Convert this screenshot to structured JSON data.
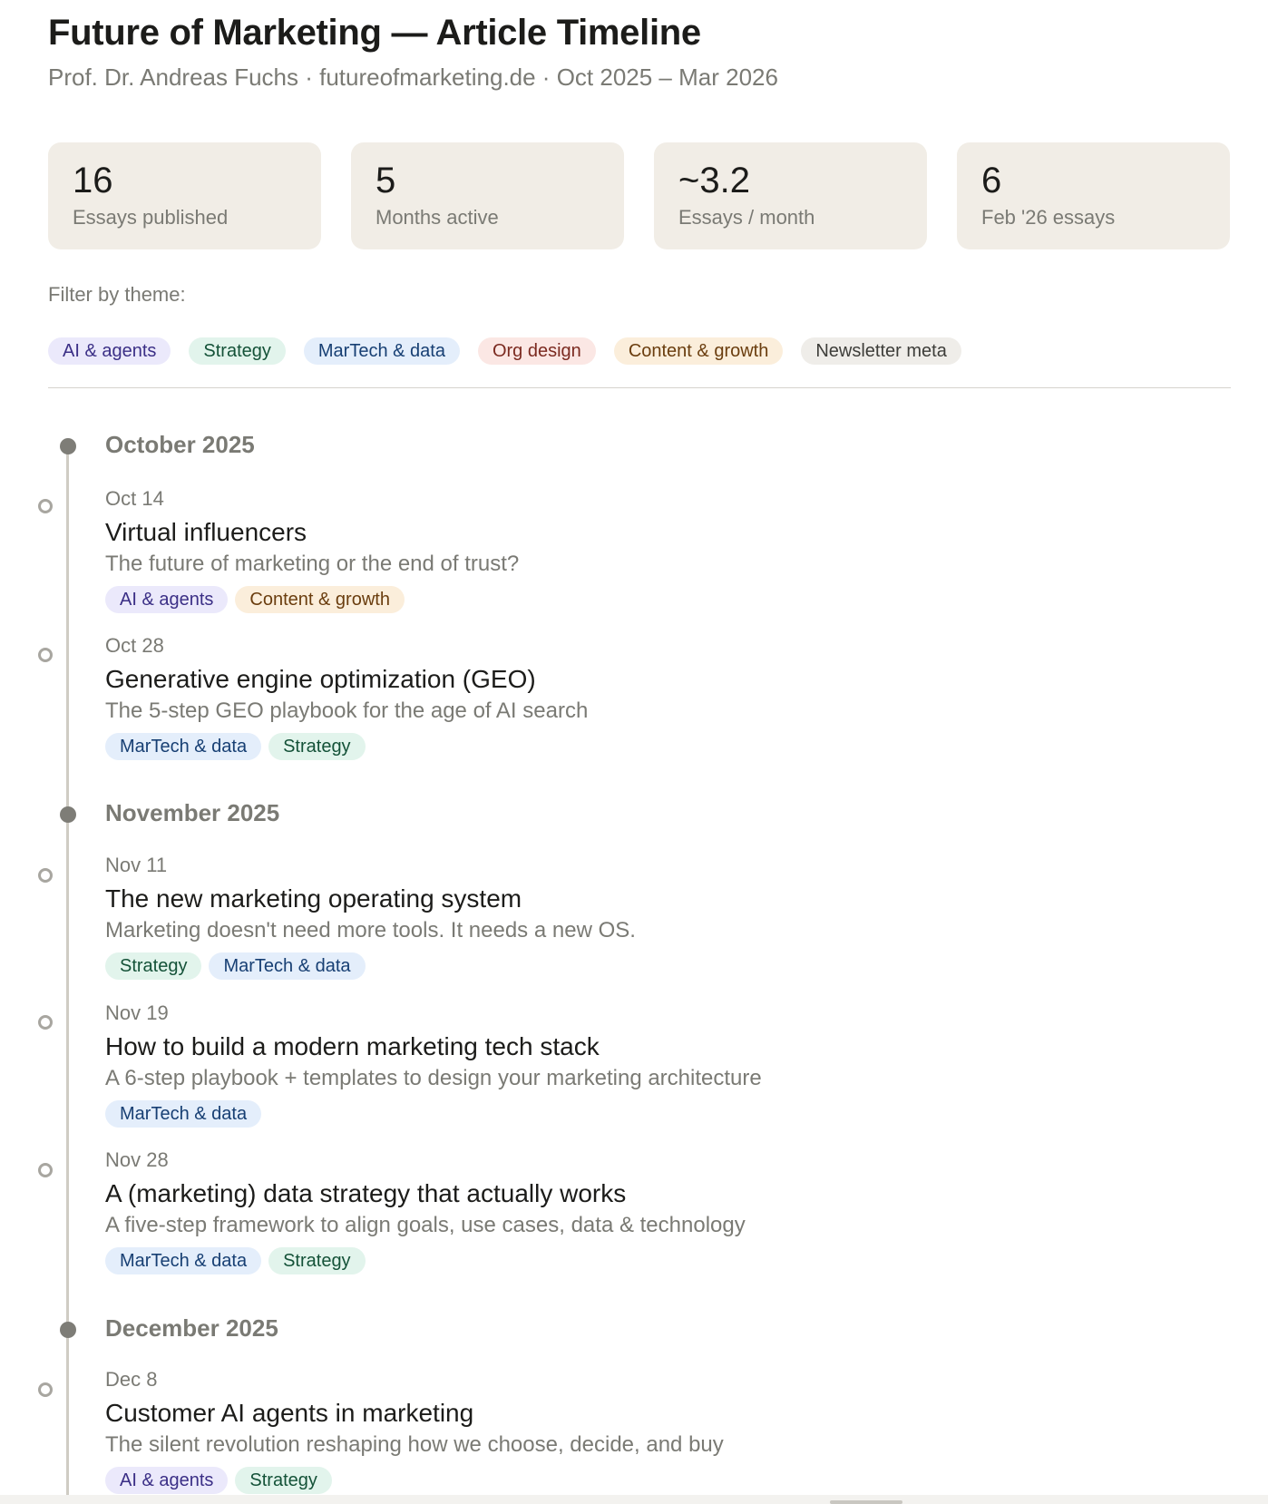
{
  "header": {
    "title": "Future of Marketing — Article Timeline",
    "subtitle": "Prof. Dr. Andreas Fuchs · futureofmarketing.de · Oct 2025 – Mar 2026"
  },
  "stats": [
    {
      "value": "16",
      "label": "Essays published"
    },
    {
      "value": "5",
      "label": "Months active"
    },
    {
      "value": "~3.2",
      "label": "Essays / month"
    },
    {
      "value": "6",
      "label": "Feb '26 essays"
    }
  ],
  "filter": {
    "label": "Filter by theme:",
    "themes": [
      "AI & agents",
      "Strategy",
      "MarTech & data",
      "Org design",
      "Content & growth",
      "Newsletter meta"
    ]
  },
  "timeline": {
    "months": [
      "October 2025",
      "November 2025",
      "December 2025"
    ],
    "entries": [
      {
        "date": "Oct 14",
        "title": "Virtual influencers",
        "desc": "The future of marketing or the end of trust?",
        "tags": [
          "AI & agents",
          "Content & growth"
        ]
      },
      {
        "date": "Oct 28",
        "title": "Generative engine optimization (GEO)",
        "desc": "The 5-step GEO playbook for the age of AI search",
        "tags": [
          "MarTech & data",
          "Strategy"
        ]
      },
      {
        "date": "Nov 11",
        "title": "The new marketing operating system",
        "desc": "Marketing doesn't need more tools. It needs a new OS.",
        "tags": [
          "Strategy",
          "MarTech & data"
        ]
      },
      {
        "date": "Nov 19",
        "title": "How to build a modern marketing tech stack",
        "desc": "A 6-step playbook + templates to design your marketing architecture",
        "tags": [
          "MarTech & data"
        ]
      },
      {
        "date": "Nov 28",
        "title": "A (marketing) data strategy that actually works",
        "desc": "A five-step framework to align goals, use cases, data & technology",
        "tags": [
          "MarTech & data",
          "Strategy"
        ]
      },
      {
        "date": "Dec 8",
        "title": "Customer AI agents in marketing",
        "desc": "The silent revolution reshaping how we choose, decide, and buy",
        "tags": [
          "AI & agents",
          "Strategy"
        ]
      }
    ]
  }
}
